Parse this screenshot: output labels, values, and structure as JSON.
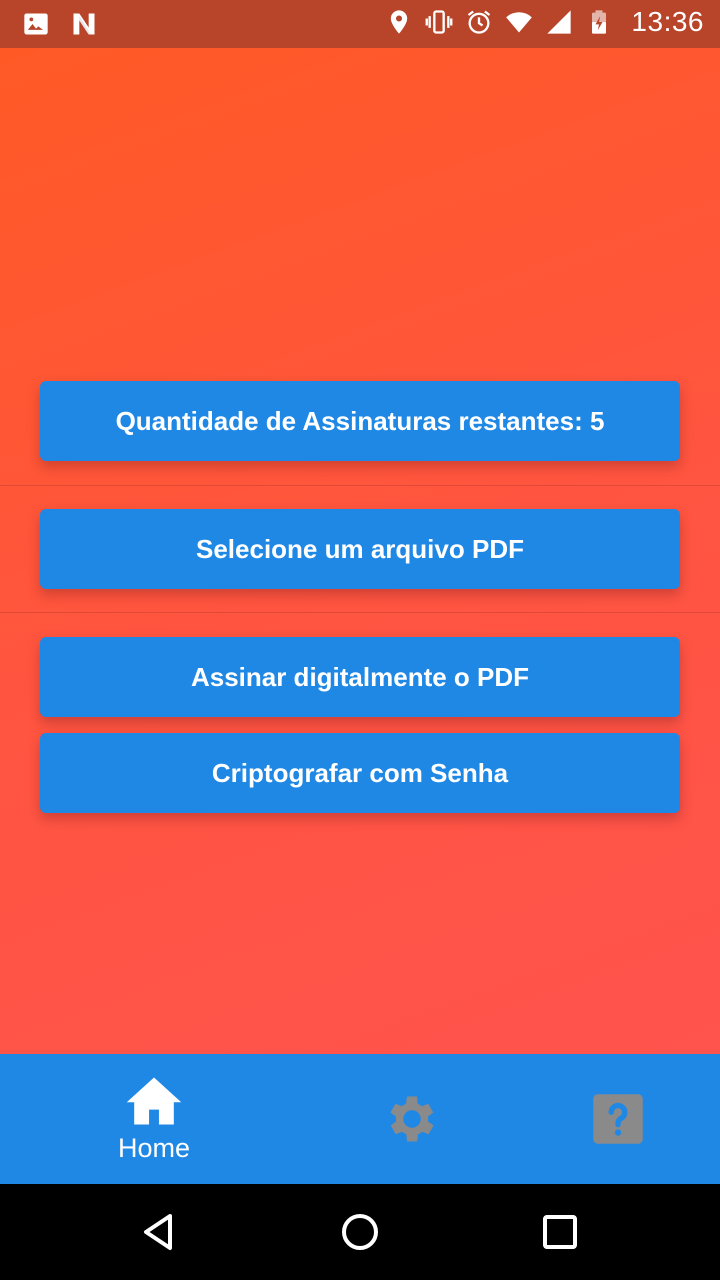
{
  "status_bar": {
    "time": "13:36",
    "left_icons": [
      "image-icon",
      "n-logo-icon"
    ],
    "right_icons": [
      "location-icon",
      "vibrate-icon",
      "alarm-icon",
      "wifi-icon",
      "signal-icon",
      "battery-icon"
    ]
  },
  "main": {
    "signatures_remaining_label": "Quantidade de Assinaturas restantes: 5",
    "select_pdf_label": "Selecione um arquivo PDF",
    "sign_pdf_label": "Assinar digitalmente o PDF",
    "encrypt_label": "Criptografar com Senha"
  },
  "bottom_nav": {
    "items": [
      {
        "label": "Home",
        "icon": "home-icon",
        "active": true
      },
      {
        "label": "",
        "icon": "gear-icon",
        "active": false
      },
      {
        "label": "",
        "icon": "help-icon",
        "active": false
      }
    ]
  },
  "system_nav": {
    "icons": [
      "back-icon",
      "home-circle-icon",
      "recent-apps-icon"
    ]
  },
  "colors": {
    "accent": "#1f88e5",
    "background_top": "#ff5a24",
    "background_bottom": "#ff5252",
    "status_bar": "#b8442a",
    "inactive_icon": "#8a8a8a"
  }
}
